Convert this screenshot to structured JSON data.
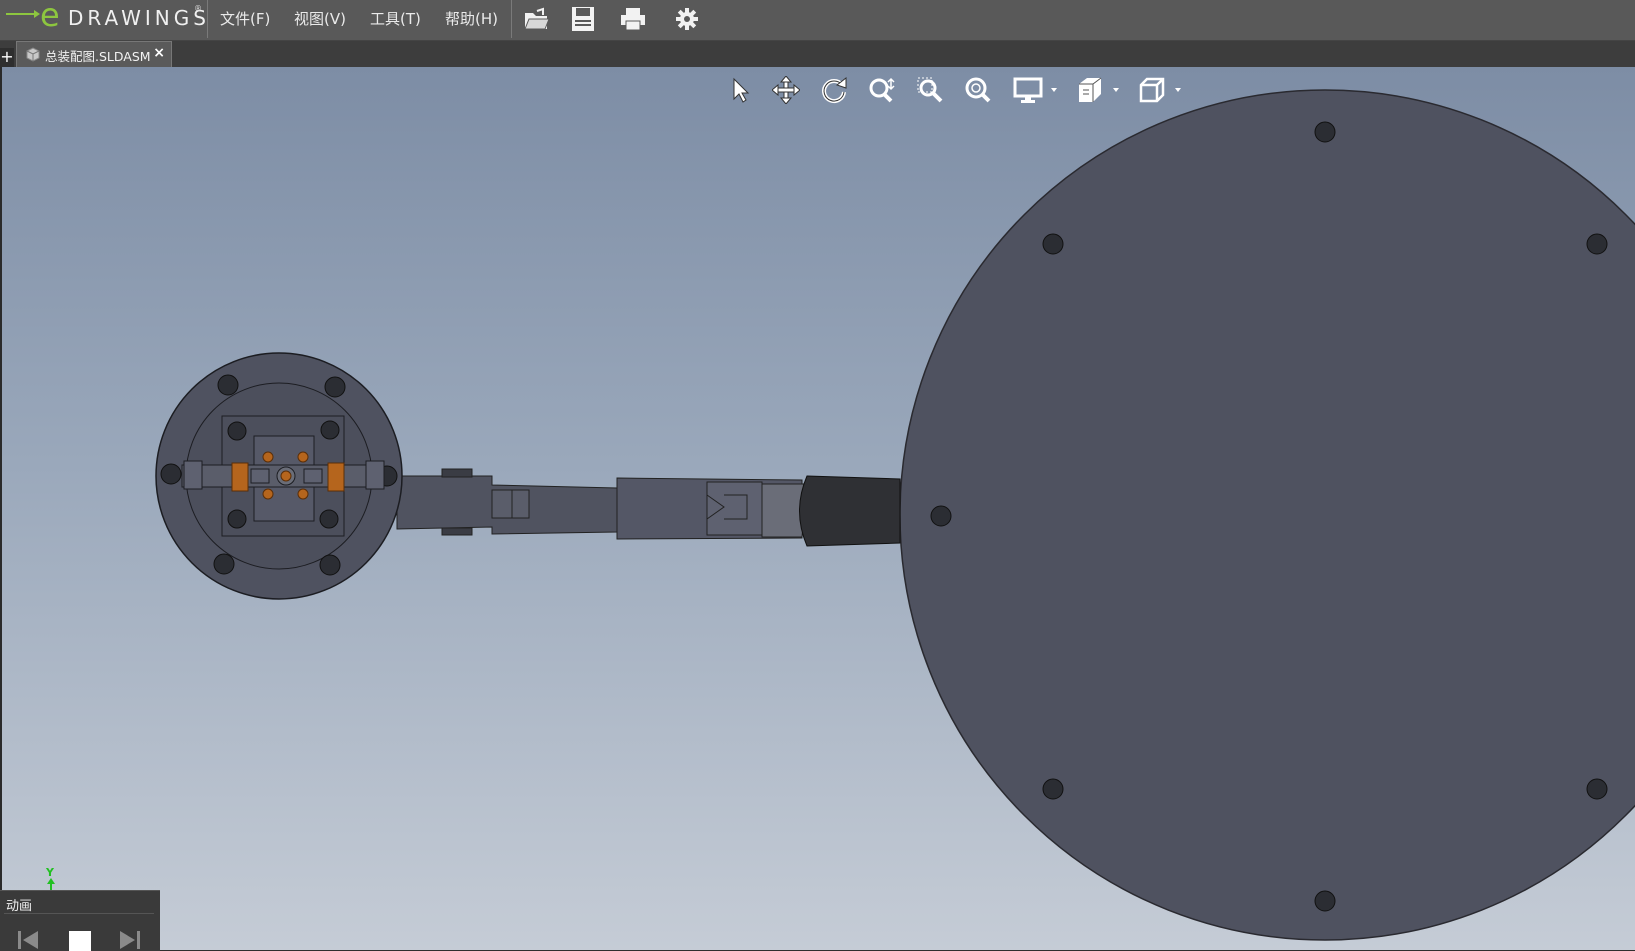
{
  "app": {
    "logo_text": "DRAWINGS",
    "logo_mark": "e",
    "logo_reg": "®"
  },
  "menu": [
    {
      "label": "文件(F)"
    },
    {
      "label": "视图(V)"
    },
    {
      "label": "工具(T)"
    },
    {
      "label": "帮助(H)"
    }
  ],
  "toolbar_icons": [
    "open-folder-icon",
    "save-icon",
    "print-icon",
    "settings-gear-icon"
  ],
  "tabs": {
    "add": "+",
    "document": {
      "label": "总装配图.SLDASM",
      "close": "×",
      "icon": "assembly-icon"
    }
  },
  "view_tools": [
    "select-icon",
    "pan-icon",
    "rotate-icon",
    "zoom-icon",
    "zoom-to-area-icon",
    "zoom-to-fit-icon",
    "display-style-icon",
    "section-icon",
    "standard-views-icon"
  ],
  "triad": {
    "y_label": "Y"
  },
  "animation": {
    "title": "动画",
    "buttons": [
      "previous-icon",
      "stop-icon",
      "next-icon"
    ]
  },
  "colors": {
    "viewport_top": "#7d8da5",
    "viewport_bottom": "#c5ccd6",
    "part_gray": "#4f5260",
    "accent_green": "#8dc63f"
  }
}
